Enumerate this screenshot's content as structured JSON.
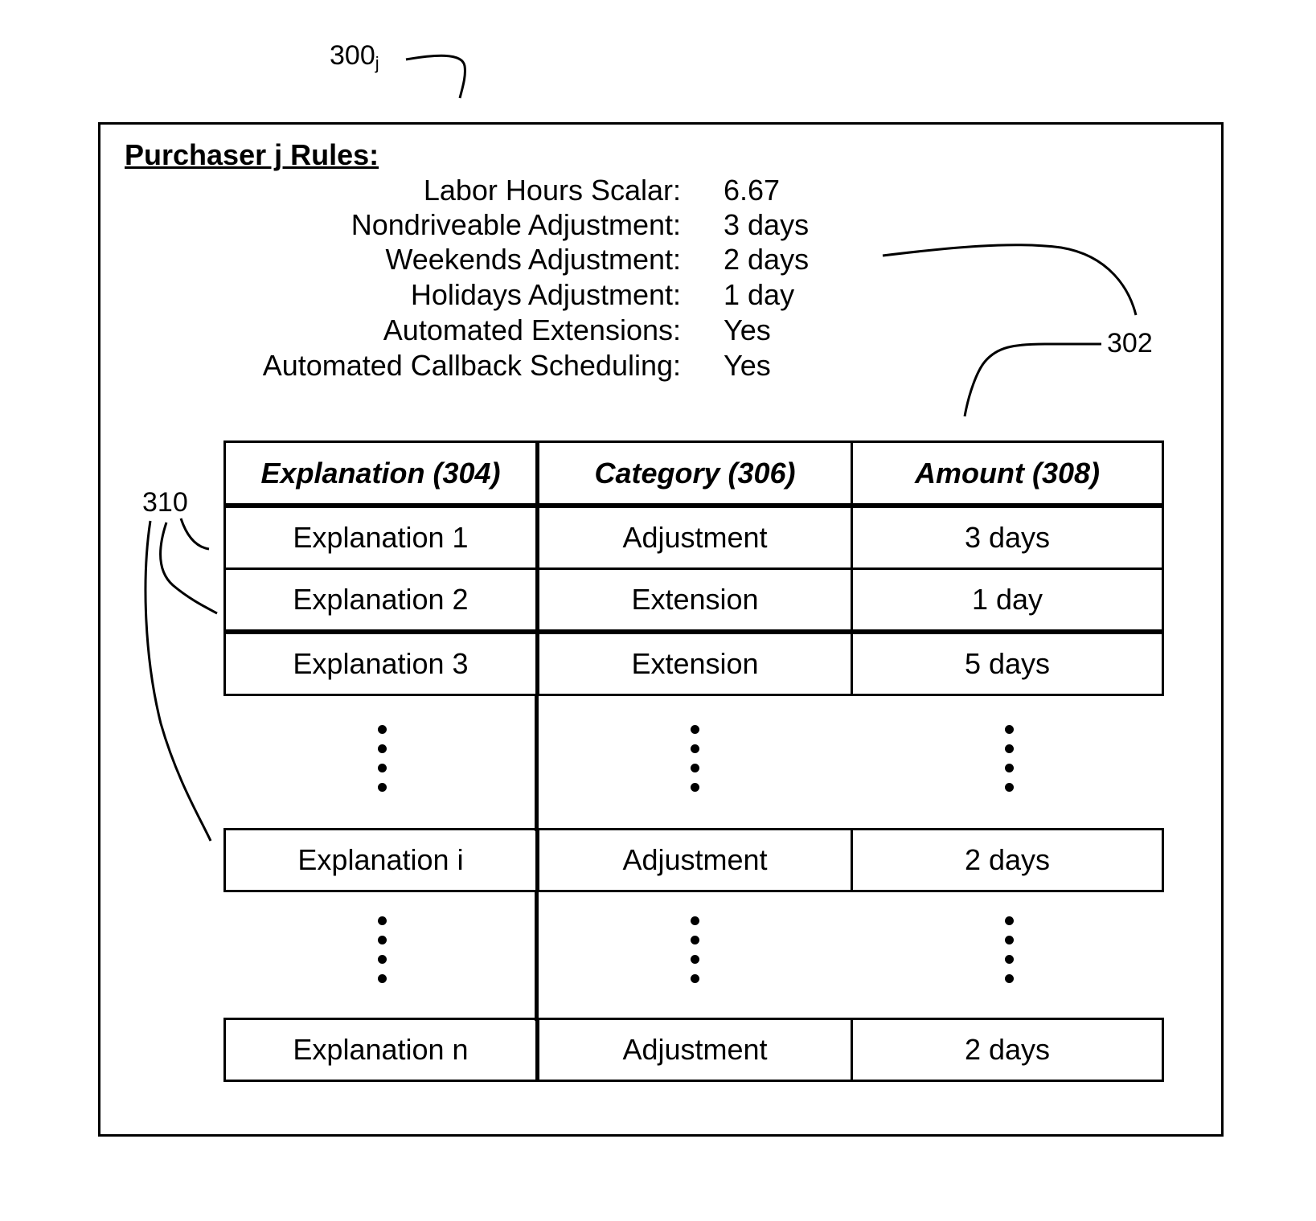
{
  "figure": {
    "reference_main": "300",
    "reference_main_subscript": "j",
    "reference_rules_block": "302",
    "reference_rows": "310"
  },
  "rules": {
    "title": "Purchaser j Rules:",
    "items": [
      {
        "label": "Labor Hours Scalar:",
        "value": "6.67"
      },
      {
        "label": "Nondriveable Adjustment:",
        "value": "3 days"
      },
      {
        "label": "Weekends Adjustment:",
        "value": "2 days"
      },
      {
        "label": "Holidays Adjustment:",
        "value": "1 day"
      },
      {
        "label": "Automated Extensions:",
        "value": "Yes"
      },
      {
        "label": "Automated Callback Scheduling:",
        "value": "Yes"
      }
    ]
  },
  "table": {
    "headers": [
      "Explanation (304)",
      "Category (306)",
      "Amount (308)"
    ],
    "rows": [
      {
        "explanation": "Explanation 1",
        "category": "Adjustment",
        "amount": "3 days"
      },
      {
        "explanation": "Explanation 2",
        "category": "Extension",
        "amount": "1 day"
      },
      {
        "explanation": "Explanation 3",
        "category": "Extension",
        "amount": "5 days"
      },
      {
        "explanation": "Explanation i",
        "category": "Adjustment",
        "amount": "2 days"
      },
      {
        "explanation": "Explanation n",
        "category": "Adjustment",
        "amount": "2 days"
      }
    ],
    "ellipsis_marker": "⋮"
  }
}
